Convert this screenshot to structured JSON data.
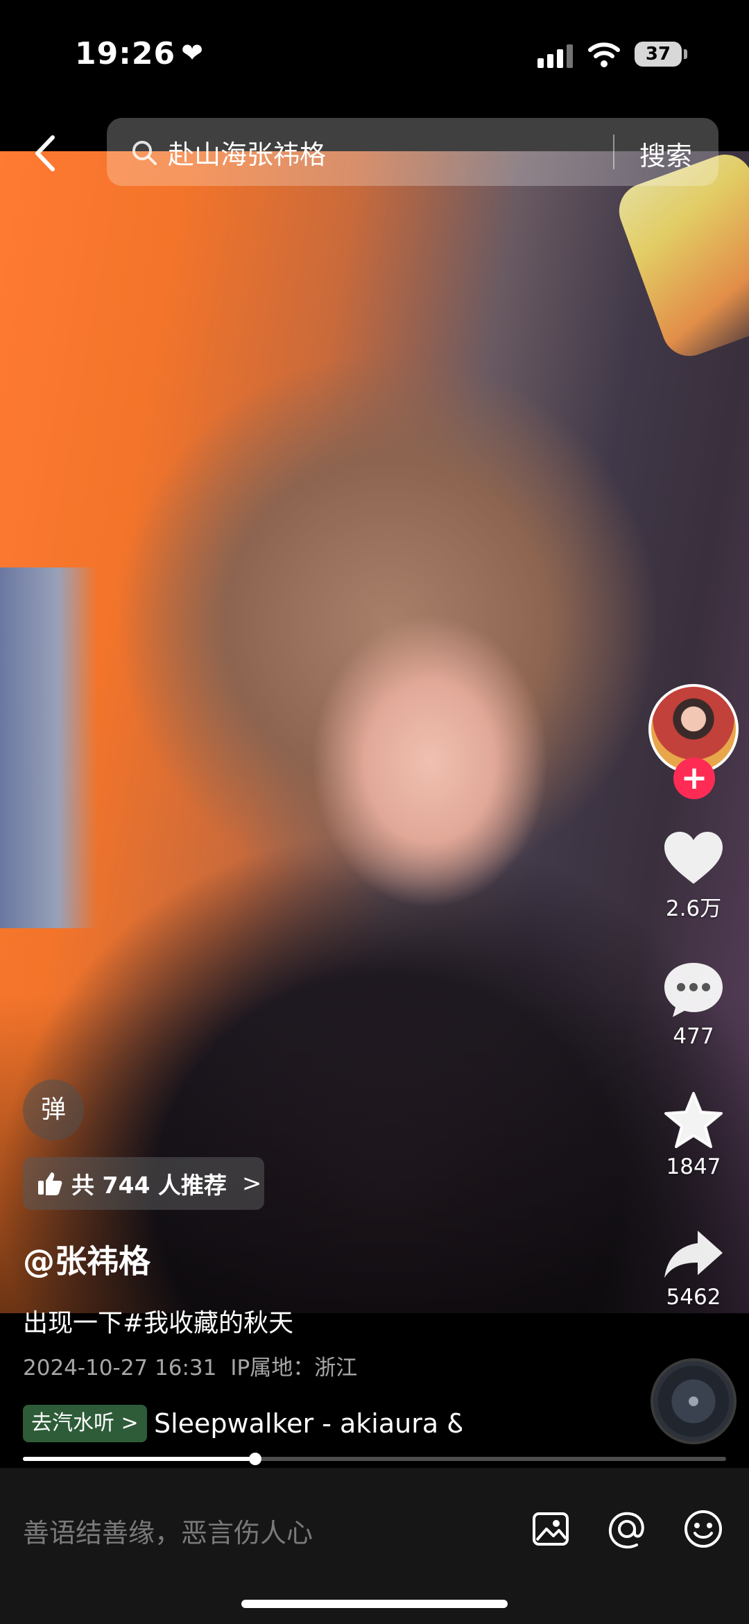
{
  "status": {
    "time": "19:26",
    "battery": "37"
  },
  "search": {
    "query": "赴山海张祎格",
    "button": "搜索"
  },
  "actions": {
    "likes": "2.6万",
    "comments": "477",
    "favorites": "1847",
    "shares": "5462"
  },
  "follow_glyph": "+",
  "danmu_label": "弹",
  "recommend": {
    "text": "共 744 人推荐",
    "arrow": ">"
  },
  "post": {
    "author": "@张祎格",
    "caption": "出现一下#我收藏的秋天",
    "date": "2024-10-27 16:31",
    "ip": "IP属地：浙江"
  },
  "music": {
    "tag": "去汽水听 >",
    "title": "Sleepwalker - akiaura &"
  },
  "progress": {
    "fraction": 0.33
  },
  "comment": {
    "placeholder": "善语结善缘，恶言伤人心"
  },
  "colors": {
    "accent": "#fe2c55",
    "music_tag_bg": "#2e5c38"
  },
  "icons": [
    "heart-icon",
    "search-icon",
    "back-icon",
    "like-icon",
    "comment-icon",
    "favorite-icon",
    "share-icon",
    "thumbs-up-icon",
    "image-icon",
    "mention-icon",
    "emoji-icon"
  ]
}
